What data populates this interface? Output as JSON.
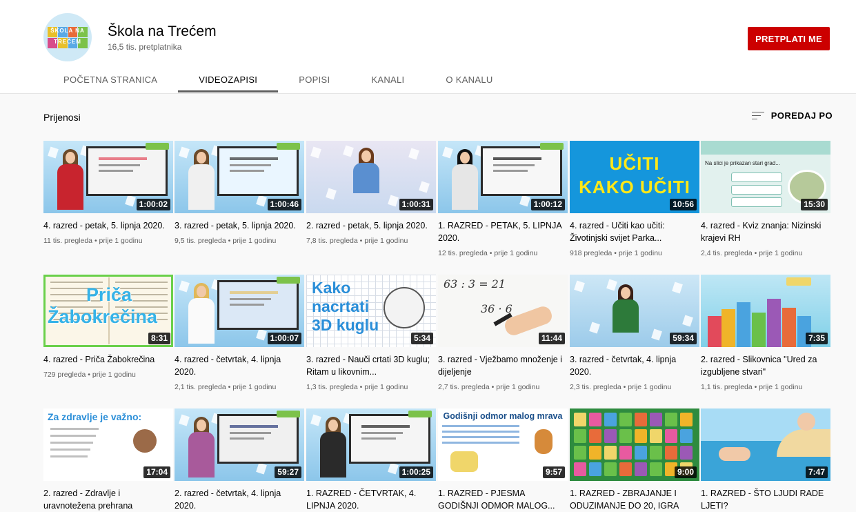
{
  "channel": {
    "name": "Škola na Trećem",
    "subscribers": "16,5 tis. pretplatnika",
    "logo_rows": [
      "ŠKOLA NA",
      "TREĆEM"
    ],
    "subscribe_label": "PRETPLATI ME",
    "subscribe_color": "#cc0000"
  },
  "tabs": [
    {
      "label": "POČETNA STRANICA",
      "active": false
    },
    {
      "label": "VIDEOZAPISI",
      "active": true
    },
    {
      "label": "POPISI",
      "active": false
    },
    {
      "label": "KANALI",
      "active": false
    },
    {
      "label": "O KANALU",
      "active": false
    }
  ],
  "section": {
    "title": "Prijenosi",
    "sort_label": "POREDAJ PO",
    "sort_icon": "sort-icon"
  },
  "videos": [
    {
      "title": "4. razred - petak, 5. lipnja 2020.",
      "duration": "1:00:02",
      "views": "11 tis. pregleda",
      "age": "prije 1 godinu"
    },
    {
      "title": "3. razred - petak, 5. lipnja 2020.",
      "duration": "1:00:46",
      "views": "9,5 tis. pregleda",
      "age": "prije 1 godinu"
    },
    {
      "title": "2. razred - petak, 5. lipnja 2020.",
      "duration": "1:00:31",
      "views": "7,8 tis. pregleda",
      "age": "prije 1 godinu"
    },
    {
      "title": "1. RAZRED - PETAK, 5. LIPNJA 2020.",
      "duration": "1:00:12",
      "views": "12 tis. pregleda",
      "age": "prije 1 godinu"
    },
    {
      "title": "4. razred - Učiti kao učiti: Životinjski svijet Parka...",
      "duration": "10:56",
      "views": "918 pregleda",
      "age": "prije 1 godinu",
      "thumb_text": [
        "UČITI",
        "KAKO UČITI"
      ]
    },
    {
      "title": "4. razred - Kviz znanja: Nizinski krajevi RH",
      "duration": "15:30",
      "views": "2,4 tis. pregleda",
      "age": "prije 1 godinu",
      "thumb_text": [
        "Na slici je prikazan stari grad..."
      ]
    },
    {
      "title": "4. razred - Priča Žabokrečina",
      "duration": "8:31",
      "views": "729 pregleda",
      "age": "prije 1 godinu",
      "thumb_text": [
        "Priča",
        "Žabokrečina"
      ]
    },
    {
      "title": "4. razred - četvrtak, 4. lipnja 2020.",
      "duration": "1:00:07",
      "views": "2,1 tis. pregleda",
      "age": "prije 1 godinu"
    },
    {
      "title": "3. razred - Nauči crtati 3D kuglu; Ritam u likovnim...",
      "duration": "5:34",
      "views": "1,3 tis. pregleda",
      "age": "prije 1 godinu",
      "thumb_text": [
        "Kako",
        "nacrtati",
        "3D kuglu"
      ]
    },
    {
      "title": "3. razred - Vježbamo množenje i dijeljenje",
      "duration": "11:44",
      "views": "2,7 tis. pregleda",
      "age": "prije 1 godinu",
      "thumb_text": [
        "63 : 3 = 21",
        "36 · 6"
      ]
    },
    {
      "title": "3. razred - četvrtak, 4. lipnja 2020.",
      "duration": "59:34",
      "views": "2,3 tis. pregleda",
      "age": "prije 1 godinu"
    },
    {
      "title": "2. razred - Slikovnica \"Ured za izgubljene stvari\"",
      "duration": "7:35",
      "views": "1,1 tis. pregleda",
      "age": "prije 1 godinu"
    },
    {
      "title": "2. razred - Zdravlje i uravnotežena prehrana",
      "duration": "17:04",
      "views": "",
      "age": "",
      "thumb_text": [
        "Za zdravlje je važno:"
      ]
    },
    {
      "title": "2. razred - četvrtak, 4. lipnja 2020.",
      "duration": "59:27",
      "views": "",
      "age": ""
    },
    {
      "title": "1. RAZRED - ČETVRTAK, 4. LIPNJA 2020.",
      "duration": "1:00:25",
      "views": "",
      "age": ""
    },
    {
      "title": "1. RAZRED - PJESMA GODIŠNJI ODMOR MALOG...",
      "duration": "9:57",
      "views": "",
      "age": "",
      "thumb_text": [
        "Godišnji odmor malog mrava"
      ]
    },
    {
      "title": "1. RAZRED - ZBRAJANJE I ODUZIMANJE DO 20, IGRA",
      "duration": "9:00",
      "views": "",
      "age": ""
    },
    {
      "title": "1. RAZRED - ŠTO LJUDI RADE LJETI?",
      "duration": "7:47",
      "views": "",
      "age": ""
    }
  ]
}
